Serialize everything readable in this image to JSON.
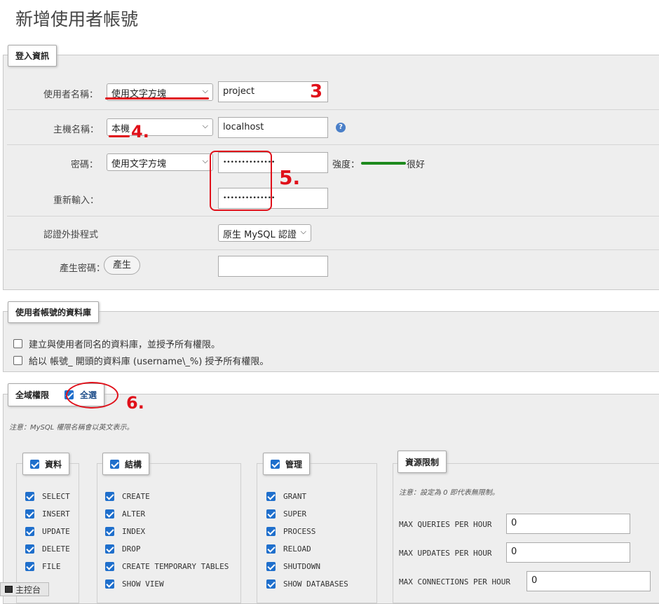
{
  "page_title": "新增使用者帳號",
  "login": {
    "legend": "登入資訊",
    "username_label": "使用者名稱：",
    "username_select": "使用文字方塊",
    "username_value": "project",
    "host_label": "主機名稱：",
    "host_select": "本機",
    "host_value": "localhost",
    "password_label": "密碼：",
    "password_select": "使用文字方塊",
    "password_value": "••••••••••••••",
    "strength_label": "強度：",
    "strength_text": "很好",
    "retype_label": "重新輸入：",
    "retype_value": "••••••••••••••",
    "auth_label": "認證外掛程式",
    "auth_select": "原生 MySQL 認證",
    "generate_label": "產生密碼：",
    "generate_button": "產生",
    "generate_value": ""
  },
  "database": {
    "legend": "使用者帳號的資料庫",
    "opt1": "建立與使用者同名的資料庫，並授予所有權限。",
    "opt2": "給以 帳號_ 開頭的資料庫 (username\\_%) 授予所有權限。"
  },
  "global": {
    "legend": "全域權限",
    "select_all": "全選",
    "note": "注意：MySQL 權限名稱會以英文表示。",
    "data": {
      "title": "資料",
      "items": [
        "SELECT",
        "INSERT",
        "UPDATE",
        "DELETE",
        "FILE"
      ]
    },
    "structure": {
      "title": "結構",
      "items": [
        "CREATE",
        "ALTER",
        "INDEX",
        "DROP",
        "CREATE TEMPORARY TABLES",
        "SHOW VIEW"
      ]
    },
    "admin": {
      "title": "管理",
      "items": [
        "GRANT",
        "SUPER",
        "PROCESS",
        "RELOAD",
        "SHUTDOWN",
        "SHOW DATABASES"
      ]
    },
    "limits": {
      "title": "資源限制",
      "note": "注意：設定為 0 即代表無限制。",
      "max_queries_label": "MAX QUERIES PER HOUR",
      "max_queries_value": "0",
      "max_updates_label": "MAX UPDATES PER HOUR",
      "max_updates_value": "0",
      "max_connections_label": "MAX CONNECTIONS PER HOUR",
      "max_connections_value": "0"
    }
  },
  "annotations": {
    "a3": "3",
    "a4": "4.",
    "a5": "5.",
    "a6": "6."
  },
  "console": "主控台",
  "colors": {
    "accent": "#1f6fcc",
    "strength": "#1e8a1e",
    "annotation": "#e0101a"
  }
}
